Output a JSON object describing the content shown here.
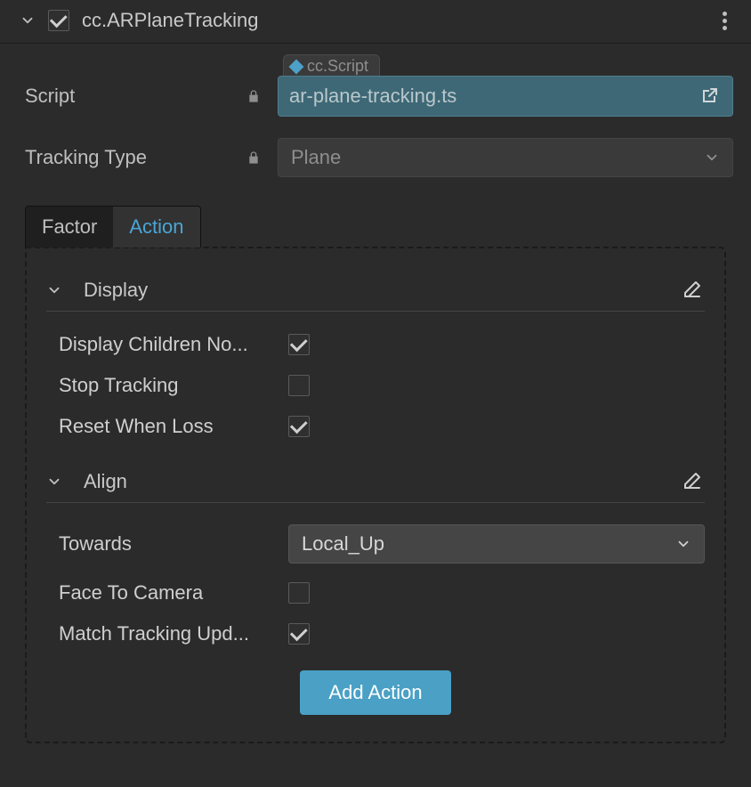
{
  "component": {
    "enabled": true,
    "title": "cc.ARPlaneTracking"
  },
  "props": {
    "script": {
      "label": "Script",
      "tag": "cc.Script",
      "value": "ar-plane-tracking.ts",
      "locked": true
    },
    "trackingType": {
      "label": "Tracking Type",
      "value": "Plane",
      "locked": true
    }
  },
  "tabs": {
    "items": [
      "Factor",
      "Action"
    ],
    "active": 1
  },
  "sections": [
    {
      "title": "Display",
      "props": [
        {
          "label": "Display Children No...",
          "type": "checkbox",
          "value": true
        },
        {
          "label": "Stop Tracking",
          "type": "checkbox",
          "value": false
        },
        {
          "label": "Reset When Loss",
          "type": "checkbox",
          "value": true
        }
      ]
    },
    {
      "title": "Align",
      "props": [
        {
          "label": "Towards",
          "type": "select",
          "value": "Local_Up"
        },
        {
          "label": "Face To Camera",
          "type": "checkbox",
          "value": false
        },
        {
          "label": "Match Tracking Upd...",
          "type": "checkbox",
          "value": true
        }
      ]
    }
  ],
  "addButton": "Add Action"
}
